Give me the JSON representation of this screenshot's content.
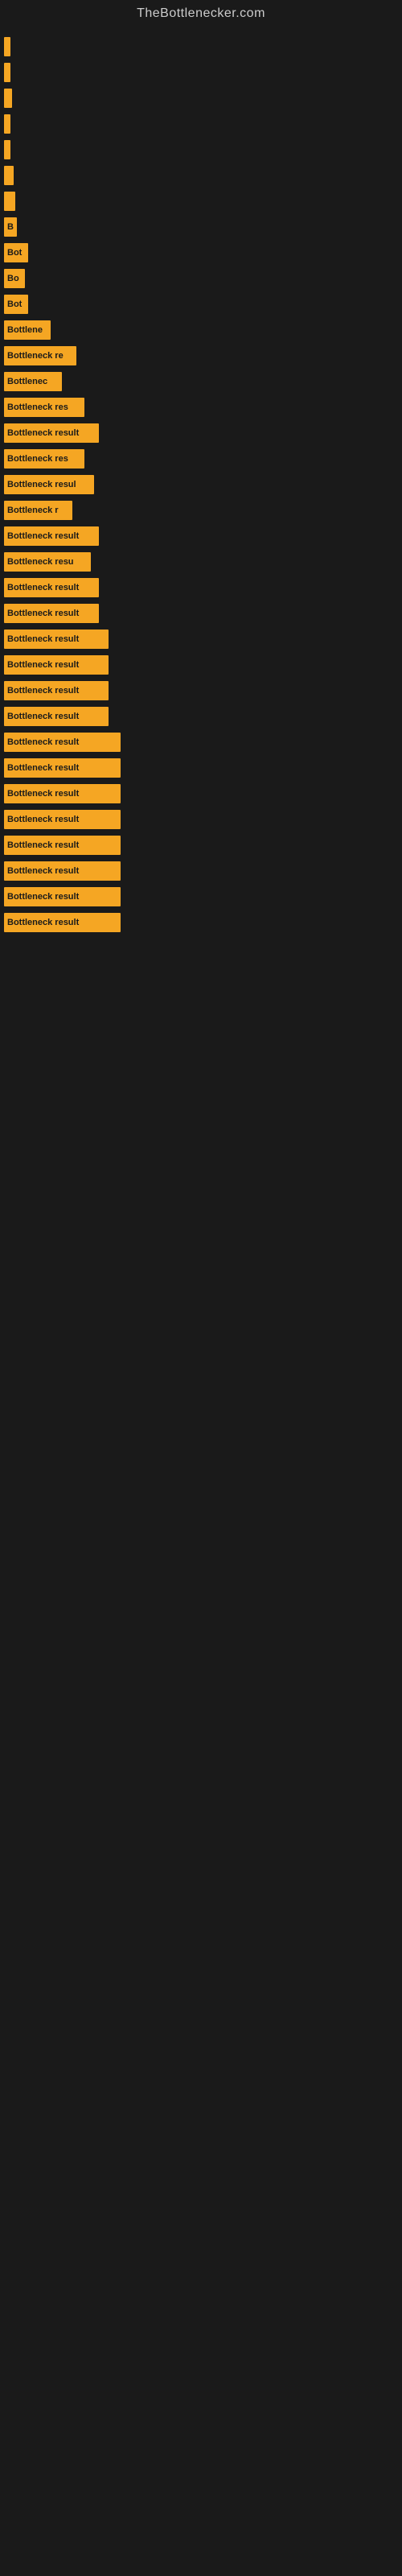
{
  "site": {
    "title": "TheBottlenecker.com"
  },
  "items": [
    {
      "label": "",
      "width": 8
    },
    {
      "label": "",
      "width": 8
    },
    {
      "label": "",
      "width": 10
    },
    {
      "label": "",
      "width": 8
    },
    {
      "label": "",
      "width": 8
    },
    {
      "label": "",
      "width": 12
    },
    {
      "label": "",
      "width": 14
    },
    {
      "label": "B",
      "width": 16
    },
    {
      "label": "Bot",
      "width": 30
    },
    {
      "label": "Bo",
      "width": 26
    },
    {
      "label": "Bot",
      "width": 30
    },
    {
      "label": "Bottlene",
      "width": 58
    },
    {
      "label": "Bottleneck re",
      "width": 90
    },
    {
      "label": "Bottlenec",
      "width": 72
    },
    {
      "label": "Bottleneck res",
      "width": 100
    },
    {
      "label": "Bottleneck result",
      "width": 118
    },
    {
      "label": "Bottleneck res",
      "width": 100
    },
    {
      "label": "Bottleneck resul",
      "width": 112
    },
    {
      "label": "Bottleneck r",
      "width": 85
    },
    {
      "label": "Bottleneck result",
      "width": 118
    },
    {
      "label": "Bottleneck resu",
      "width": 108
    },
    {
      "label": "Bottleneck result",
      "width": 118
    },
    {
      "label": "Bottleneck result",
      "width": 118
    },
    {
      "label": "Bottleneck result",
      "width": 130
    },
    {
      "label": "Bottleneck result",
      "width": 130
    },
    {
      "label": "Bottleneck result",
      "width": 130
    },
    {
      "label": "Bottleneck result",
      "width": 130
    },
    {
      "label": "Bottleneck result",
      "width": 145
    },
    {
      "label": "Bottleneck result",
      "width": 145
    },
    {
      "label": "Bottleneck result",
      "width": 145
    },
    {
      "label": "Bottleneck result",
      "width": 145
    },
    {
      "label": "Bottleneck result",
      "width": 145
    },
    {
      "label": "Bottleneck result",
      "width": 145
    },
    {
      "label": "Bottleneck result",
      "width": 145
    },
    {
      "label": "Bottleneck result",
      "width": 145
    }
  ]
}
